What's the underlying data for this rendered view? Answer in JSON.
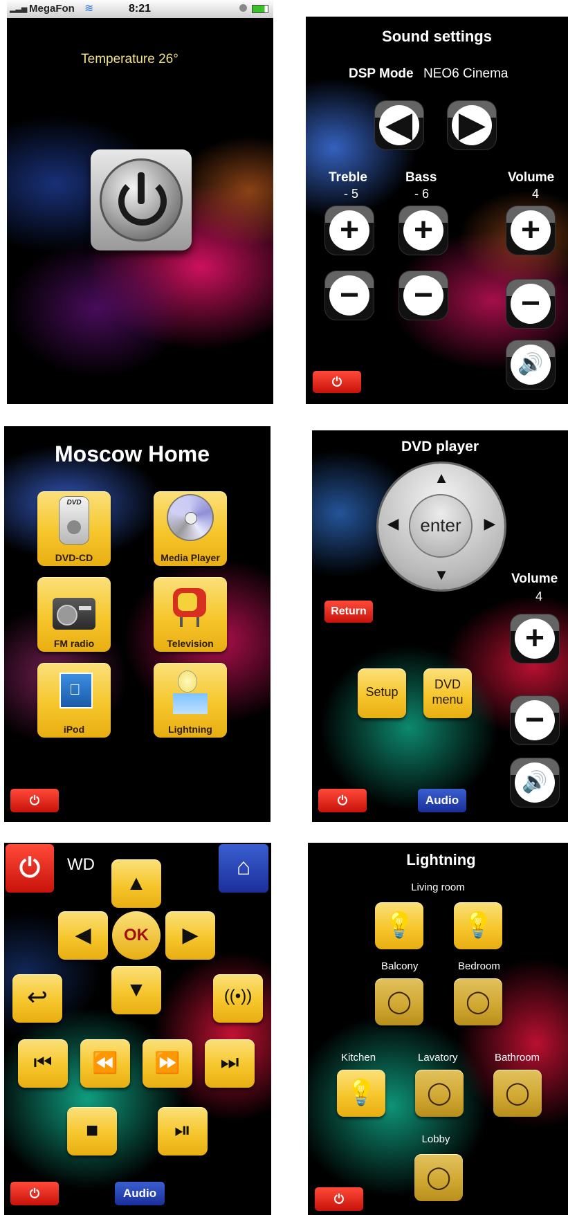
{
  "status_bar": {
    "carrier": "MegaFon",
    "time": "8:21"
  },
  "panel_power": {
    "temperature": "Temperature 26°"
  },
  "sound": {
    "title": "Sound settings",
    "dsp_label": "DSP Mode",
    "dsp_value": "NEO6 Cinema",
    "treble_label": "Treble",
    "treble_value": "- 5",
    "bass_label": "Bass",
    "bass_value": "- 6",
    "volume_label": "Volume",
    "volume_value": "4"
  },
  "home": {
    "title": "Moscow Home",
    "tiles": [
      {
        "label": "DVD-CD"
      },
      {
        "label": "Media Player"
      },
      {
        "label": "FM radio"
      },
      {
        "label": "Television"
      },
      {
        "label": "iPod"
      },
      {
        "label": "Lightning"
      }
    ],
    "dvd_logo": "DVD"
  },
  "dvd": {
    "title": "DVD player",
    "enter": "enter",
    "volume_label": "Volume",
    "volume_value": "4",
    "return": "Return",
    "setup": "Setup",
    "dvd_menu_line1": "DVD",
    "dvd_menu_line2": "menu",
    "audio": "Audio"
  },
  "wd": {
    "title": "WD",
    "ok": "OK",
    "audio": "Audio"
  },
  "lighting": {
    "title": "Lightning",
    "rooms": [
      {
        "label": "Living room"
      },
      {
        "label": "Balcony"
      },
      {
        "label": "Bedroom"
      },
      {
        "label": "Kitchen"
      },
      {
        "label": "Lavatory"
      },
      {
        "label": "Bathroom"
      },
      {
        "label": "Lobby"
      }
    ]
  },
  "colors": {
    "accent_yellow": "#f6c62c",
    "red": "#d61a10",
    "blue": "#1f3aa8",
    "temp_text": "#f2e38a"
  },
  "icons": [
    "wifi-icon",
    "battery-icon",
    "power-icon",
    "arrow-left-icon",
    "arrow-right-icon",
    "plus-icon",
    "minus-icon",
    "speaker-icon",
    "home-icon",
    "back-icon",
    "broadcast-icon",
    "skip-back-icon",
    "rewind-icon",
    "fast-forward-icon",
    "skip-forward-icon",
    "stop-icon",
    "play-pause-icon",
    "bulb-icon"
  ]
}
